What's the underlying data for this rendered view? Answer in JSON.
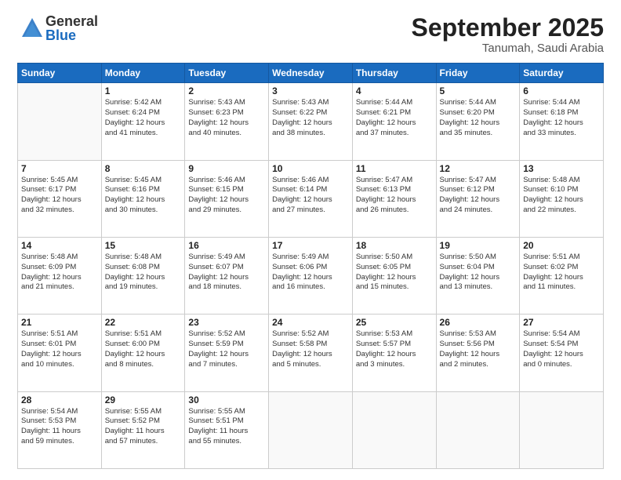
{
  "logo": {
    "general": "General",
    "blue": "Blue"
  },
  "header": {
    "month": "September 2025",
    "location": "Tanumah, Saudi Arabia"
  },
  "weekdays": [
    "Sunday",
    "Monday",
    "Tuesday",
    "Wednesday",
    "Thursday",
    "Friday",
    "Saturday"
  ],
  "weeks": [
    [
      {
        "day": "",
        "info": ""
      },
      {
        "day": "1",
        "info": "Sunrise: 5:42 AM\nSunset: 6:24 PM\nDaylight: 12 hours\nand 41 minutes."
      },
      {
        "day": "2",
        "info": "Sunrise: 5:43 AM\nSunset: 6:23 PM\nDaylight: 12 hours\nand 40 minutes."
      },
      {
        "day": "3",
        "info": "Sunrise: 5:43 AM\nSunset: 6:22 PM\nDaylight: 12 hours\nand 38 minutes."
      },
      {
        "day": "4",
        "info": "Sunrise: 5:44 AM\nSunset: 6:21 PM\nDaylight: 12 hours\nand 37 minutes."
      },
      {
        "day": "5",
        "info": "Sunrise: 5:44 AM\nSunset: 6:20 PM\nDaylight: 12 hours\nand 35 minutes."
      },
      {
        "day": "6",
        "info": "Sunrise: 5:44 AM\nSunset: 6:18 PM\nDaylight: 12 hours\nand 33 minutes."
      }
    ],
    [
      {
        "day": "7",
        "info": "Sunrise: 5:45 AM\nSunset: 6:17 PM\nDaylight: 12 hours\nand 32 minutes."
      },
      {
        "day": "8",
        "info": "Sunrise: 5:45 AM\nSunset: 6:16 PM\nDaylight: 12 hours\nand 30 minutes."
      },
      {
        "day": "9",
        "info": "Sunrise: 5:46 AM\nSunset: 6:15 PM\nDaylight: 12 hours\nand 29 minutes."
      },
      {
        "day": "10",
        "info": "Sunrise: 5:46 AM\nSunset: 6:14 PM\nDaylight: 12 hours\nand 27 minutes."
      },
      {
        "day": "11",
        "info": "Sunrise: 5:47 AM\nSunset: 6:13 PM\nDaylight: 12 hours\nand 26 minutes."
      },
      {
        "day": "12",
        "info": "Sunrise: 5:47 AM\nSunset: 6:12 PM\nDaylight: 12 hours\nand 24 minutes."
      },
      {
        "day": "13",
        "info": "Sunrise: 5:48 AM\nSunset: 6:10 PM\nDaylight: 12 hours\nand 22 minutes."
      }
    ],
    [
      {
        "day": "14",
        "info": "Sunrise: 5:48 AM\nSunset: 6:09 PM\nDaylight: 12 hours\nand 21 minutes."
      },
      {
        "day": "15",
        "info": "Sunrise: 5:48 AM\nSunset: 6:08 PM\nDaylight: 12 hours\nand 19 minutes."
      },
      {
        "day": "16",
        "info": "Sunrise: 5:49 AM\nSunset: 6:07 PM\nDaylight: 12 hours\nand 18 minutes."
      },
      {
        "day": "17",
        "info": "Sunrise: 5:49 AM\nSunset: 6:06 PM\nDaylight: 12 hours\nand 16 minutes."
      },
      {
        "day": "18",
        "info": "Sunrise: 5:50 AM\nSunset: 6:05 PM\nDaylight: 12 hours\nand 15 minutes."
      },
      {
        "day": "19",
        "info": "Sunrise: 5:50 AM\nSunset: 6:04 PM\nDaylight: 12 hours\nand 13 minutes."
      },
      {
        "day": "20",
        "info": "Sunrise: 5:51 AM\nSunset: 6:02 PM\nDaylight: 12 hours\nand 11 minutes."
      }
    ],
    [
      {
        "day": "21",
        "info": "Sunrise: 5:51 AM\nSunset: 6:01 PM\nDaylight: 12 hours\nand 10 minutes."
      },
      {
        "day": "22",
        "info": "Sunrise: 5:51 AM\nSunset: 6:00 PM\nDaylight: 12 hours\nand 8 minutes."
      },
      {
        "day": "23",
        "info": "Sunrise: 5:52 AM\nSunset: 5:59 PM\nDaylight: 12 hours\nand 7 minutes."
      },
      {
        "day": "24",
        "info": "Sunrise: 5:52 AM\nSunset: 5:58 PM\nDaylight: 12 hours\nand 5 minutes."
      },
      {
        "day": "25",
        "info": "Sunrise: 5:53 AM\nSunset: 5:57 PM\nDaylight: 12 hours\nand 3 minutes."
      },
      {
        "day": "26",
        "info": "Sunrise: 5:53 AM\nSunset: 5:56 PM\nDaylight: 12 hours\nand 2 minutes."
      },
      {
        "day": "27",
        "info": "Sunrise: 5:54 AM\nSunset: 5:54 PM\nDaylight: 12 hours\nand 0 minutes."
      }
    ],
    [
      {
        "day": "28",
        "info": "Sunrise: 5:54 AM\nSunset: 5:53 PM\nDaylight: 11 hours\nand 59 minutes."
      },
      {
        "day": "29",
        "info": "Sunrise: 5:55 AM\nSunset: 5:52 PM\nDaylight: 11 hours\nand 57 minutes."
      },
      {
        "day": "30",
        "info": "Sunrise: 5:55 AM\nSunset: 5:51 PM\nDaylight: 11 hours\nand 55 minutes."
      },
      {
        "day": "",
        "info": ""
      },
      {
        "day": "",
        "info": ""
      },
      {
        "day": "",
        "info": ""
      },
      {
        "day": "",
        "info": ""
      }
    ]
  ]
}
